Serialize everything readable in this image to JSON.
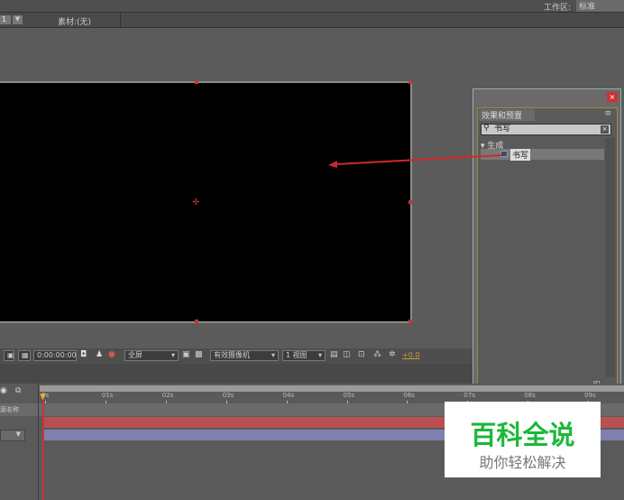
{
  "topbar": {
    "workspace_label": "工作区:",
    "workspace_value": "标准"
  },
  "tabs": {
    "comp_num": "1",
    "footage_tab": "素材:(无)"
  },
  "toolbar": {
    "timecode": "0:00:00:00",
    "resolution": "全屏",
    "camera": "有效摄像机",
    "views": "1 视图",
    "exposure": "+0.0"
  },
  "effects_panel": {
    "tab_label": "效果和预置",
    "search_value": "书写",
    "category": "生成",
    "item": "书写"
  },
  "timeline": {
    "ruler": [
      "0s",
      "01s",
      "02s",
      "03s",
      "04s",
      "05s",
      "06s",
      "07s",
      "08s",
      "09s"
    ],
    "layer_label": "源名称"
  },
  "watermark": {
    "title": "百科全说",
    "subtitle": "助你轻松解决"
  },
  "colors": {
    "accent": "#e8b020",
    "layer_red": "#b85050",
    "layer_purple": "#8080b0",
    "watermark_green": "#1db83a"
  }
}
